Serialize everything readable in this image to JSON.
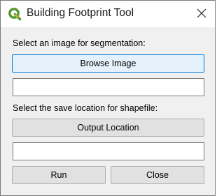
{
  "window": {
    "title": "Building Footprint Tool",
    "app_icon": "qgis-logo-icon",
    "close_icon": "close-icon"
  },
  "image_section": {
    "label": "Select an image for segmentation:",
    "browse_label": "Browse Image",
    "path_value": "",
    "path_placeholder": ""
  },
  "save_section": {
    "label": "Select the save location for shapefile:",
    "output_label": "Output Location",
    "path_value": "",
    "path_placeholder": ""
  },
  "actions": {
    "run_label": "Run",
    "close_label": "Close"
  },
  "colors": {
    "accent": "#0078d7",
    "qgis_green": "#589632",
    "qgis_yellow": "#f0b323"
  }
}
